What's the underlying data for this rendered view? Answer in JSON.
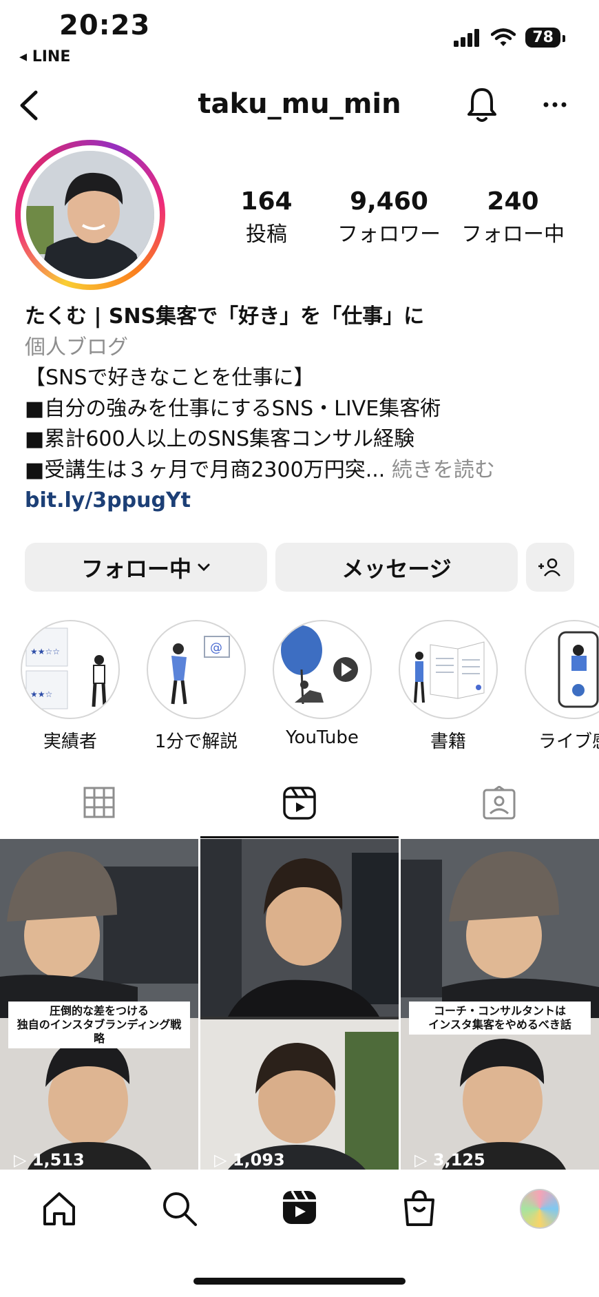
{
  "status_bar": {
    "time": "20:23",
    "back_app": "◂ LINE",
    "battery": "78"
  },
  "header": {
    "username": "taku_mu_min"
  },
  "stats": [
    {
      "value": "164",
      "label": "投稿"
    },
    {
      "value": "9,460",
      "label": "フォロワー"
    },
    {
      "value": "240",
      "label": "フォロー中"
    }
  ],
  "bio": {
    "name": "たくむ | SNS集客で「好き」を「仕事」に",
    "category": "個人ブログ",
    "lines": [
      "【SNSで好きなことを仕事に】",
      "■自分の強みを仕事にするSNS・LIVE集客術",
      "■累計600人以上のSNS集客コンサル経験",
      "■受講生は３ヶ月で月商2300万円突..."
    ],
    "more": "続きを読む",
    "link": "bit.ly/3ppugYt"
  },
  "actions": {
    "following": "フォロー中",
    "message": "メッセージ"
  },
  "highlights": [
    {
      "label": "実績者"
    },
    {
      "label": "1分で解説"
    },
    {
      "label": "YouTube"
    },
    {
      "label": "書籍"
    },
    {
      "label": "ライブ感"
    }
  ],
  "grid": [
    {
      "caption_line1": "圧倒的な差をつける",
      "caption_line2": "独自のインスタブランディング戦略",
      "views": "1,513"
    },
    {
      "caption_line1": "",
      "caption_line2": "",
      "views": "1,093"
    },
    {
      "caption_line1": "コーチ・コンサルタントは",
      "caption_line2": "インスタ集客をやめるべき話",
      "views": "3,125"
    }
  ],
  "colors": {
    "link": "#1c3f76",
    "muted": "#8e8e8e",
    "button_bg": "#efefef"
  }
}
